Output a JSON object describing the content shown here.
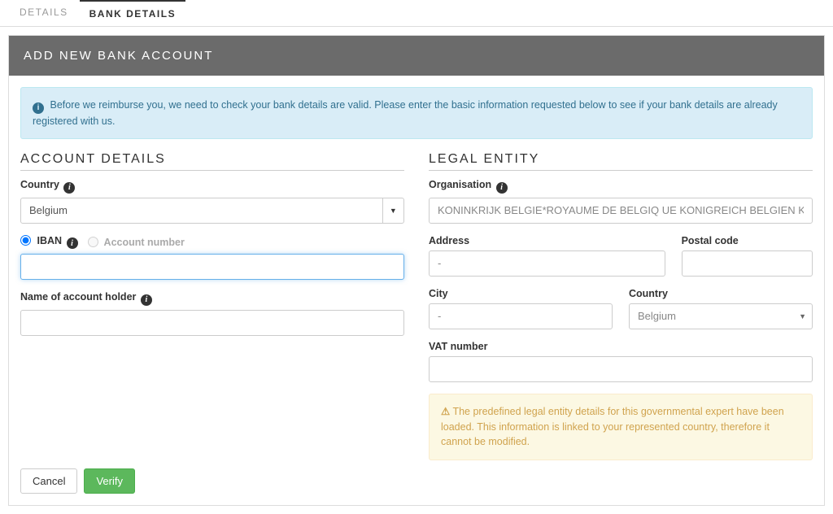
{
  "tabs": {
    "details": "DETAILS",
    "bankDetails": "BANK DETAILS"
  },
  "panel": {
    "title": "ADD NEW BANK ACCOUNT"
  },
  "infoAlert": "Before we reimburse you, we need to check your bank details are valid. Please enter the basic information requested below to see if your bank details are already registered with us.",
  "accountDetails": {
    "heading": "ACCOUNT DETAILS",
    "countryLabel": "Country",
    "countryValue": "Belgium",
    "ibanLabel": "IBAN",
    "accountNumberLabel": "Account number",
    "ibanValue": "",
    "holderLabel": "Name of account holder",
    "holderValue": ""
  },
  "legalEntity": {
    "heading": "LEGAL ENTITY",
    "orgLabel": "Organisation",
    "orgValue": "KONINKRIJK BELGIE*ROYAUME DE BELGIQ UE KONIGREICH BELGIEN KINGDOM OF BELGIUM",
    "addressLabel": "Address",
    "addressValue": "-",
    "postalLabel": "Postal code",
    "postalValue": "",
    "cityLabel": "City",
    "cityValue": "-",
    "countryLabel": "Country",
    "countryValue": "Belgium",
    "vatLabel": "VAT number",
    "vatValue": "",
    "warning": "The predefined legal entity details for this governmental expert have been loaded. This information is linked to your represented country, therefore it cannot be modified."
  },
  "buttons": {
    "cancel": "Cancel",
    "verify": "Verify"
  }
}
